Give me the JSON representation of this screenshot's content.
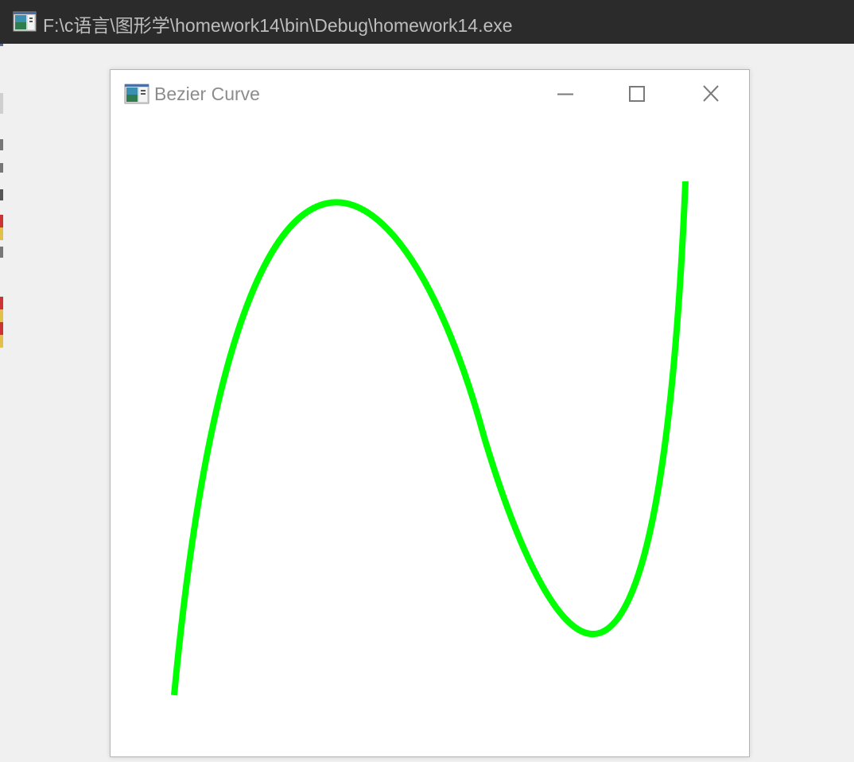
{
  "console_window": {
    "title": "F:\\c语言\\图形学\\homework14\\bin\\Debug\\homework14.exe",
    "icon": "console-app-icon"
  },
  "app_window": {
    "title": "Bezier Curve",
    "icon": "app-window-icon",
    "controls": {
      "minimize_icon": "minimize-icon",
      "maximize_icon": "maximize-icon",
      "close_icon": "close-icon"
    }
  },
  "curve": {
    "type": "cubic-bezier",
    "color": "#00ff00",
    "background": "#ffffff"
  },
  "colors": {
    "console_titlebar": "#2b2b2b",
    "console_title_text": "#bdbdbd",
    "app_title_text": "#8c8c8c",
    "window_border": "#b4b4b4"
  }
}
